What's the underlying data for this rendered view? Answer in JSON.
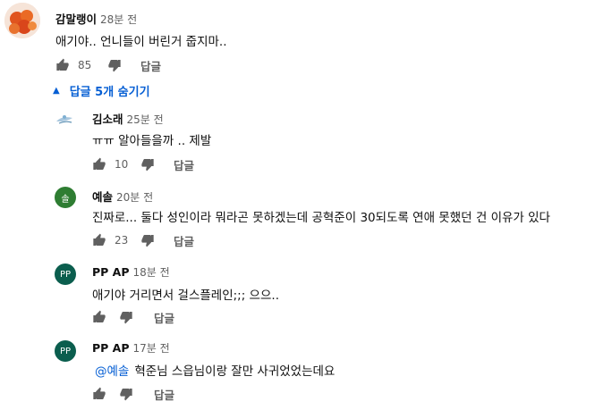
{
  "reply_label": "답글",
  "toggle_replies_label": "답글 5개 숨기기",
  "accent_color": "#065fd4",
  "main_comment": {
    "author": "감말랭이",
    "time": "28분 전",
    "text": "애기야.. 언니들이 버린거 줍지마..",
    "likes": "85",
    "avatar_icon": "food-photo-avatar"
  },
  "replies": [
    {
      "author": "김소래",
      "time": "25분 전",
      "text": "ㅠㅠ 알아들을까 .. 제발",
      "likes": "10",
      "avatar_icon": "illustration-avatar",
      "mention": ""
    },
    {
      "author": "예솔",
      "time": "20분 전",
      "text": "진짜로... 둘다 성인이라 뭐라곤 못하겠는데 공혁준이 30되도록 연애 못했던 건 이유가 있다",
      "likes": "23",
      "avatar_letter": "솔",
      "avatar_color": "#2e7d32",
      "mention": ""
    },
    {
      "author": "PP AP",
      "time": "18분 전",
      "text": "애기야 거리면서 걸스플레인;;; 으으..",
      "likes": "",
      "avatar_letter": "PP",
      "avatar_color": "#0b5e4e",
      "mention": ""
    },
    {
      "author": "PP AP",
      "time": "17분 전",
      "text": "혁준님 스읍님이랑 잘만 사귀었었는데요",
      "likes": "",
      "avatar_letter": "PP",
      "avatar_color": "#0b5e4e",
      "mention": "@예솔"
    }
  ]
}
